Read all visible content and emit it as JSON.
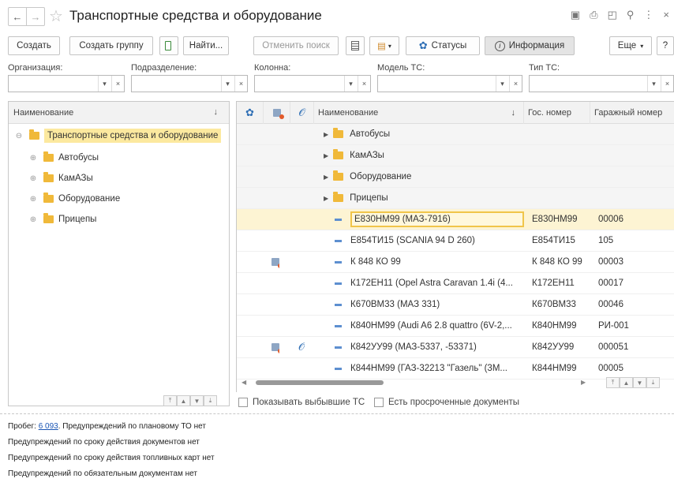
{
  "window": {
    "title": "Транспортные средства и оборудование"
  },
  "toolbar": {
    "create": "Создать",
    "create_group": "Создать группу",
    "find": "Найти...",
    "cancel_search": "Отменить поиск",
    "statuses": "Статусы",
    "information": "Информация",
    "more": "Еще",
    "help": "?"
  },
  "filters": {
    "organization": "Организация:",
    "subdivision": "Подразделение:",
    "column": "Колонна:",
    "model": "Модель ТС:",
    "type": "Тип ТС:"
  },
  "tree": {
    "header": "Наименование",
    "root": "Транспортные средства и оборудование",
    "items": [
      "Автобусы",
      "КамАЗы",
      "Оборудование",
      "Прицепы"
    ]
  },
  "table": {
    "columns": {
      "name": "Наименование",
      "gos_number": "Гос. номер",
      "garage_number": "Гаражный номер"
    },
    "groups": [
      "Автобусы",
      "КамАЗы",
      "Оборудование",
      "Прицепы"
    ],
    "rows": [
      {
        "name": "Е830НМ99 (МАЗ-7916)",
        "gos": "Е830НМ99",
        "garage": "00006"
      },
      {
        "name": "Е854ТИ15 (SCANIA 94 D 260)",
        "gos": "Е854ТИ15",
        "garage": "105"
      },
      {
        "name": "К 848 КО 99",
        "gos": "К 848 КО 99",
        "garage": "00003"
      },
      {
        "name": "К172ЕН11 (Opel Astra Caravan 1.4i (4...",
        "gos": "К172ЕН11",
        "garage": "00017"
      },
      {
        "name": "К670ВМ33 (МАЗ 331)",
        "gos": "К670ВМ33",
        "garage": "00046"
      },
      {
        "name": "К840НМ99 (Audi A6 2.8 quattro (6V-2,...",
        "gos": "К840НМ99",
        "garage": "РИ-001"
      },
      {
        "name": "К842УУ99 (МАЗ-5337, -53371)",
        "gos": "К842УУ99",
        "garage": "000051"
      },
      {
        "name": "К844НМ99 (ГАЗ-32213 \"Газель\" (3М...",
        "gos": "К844НМ99",
        "garage": "00005"
      }
    ]
  },
  "options": {
    "show_retired": "Показывать выбывшие ТС",
    "overdue_docs": "Есть просроченные документы"
  },
  "info": {
    "mileage_label": "Пробег:",
    "mileage_value": "6 093",
    "mileage_rest": ". Предупреждений по плановому ТО нет",
    "line2": "Предупреждений по сроку действия документов нет",
    "line3": "Предупреждений по сроку действия топливных карт нет",
    "line4": "Предупреждений по обязательным документам нет"
  }
}
